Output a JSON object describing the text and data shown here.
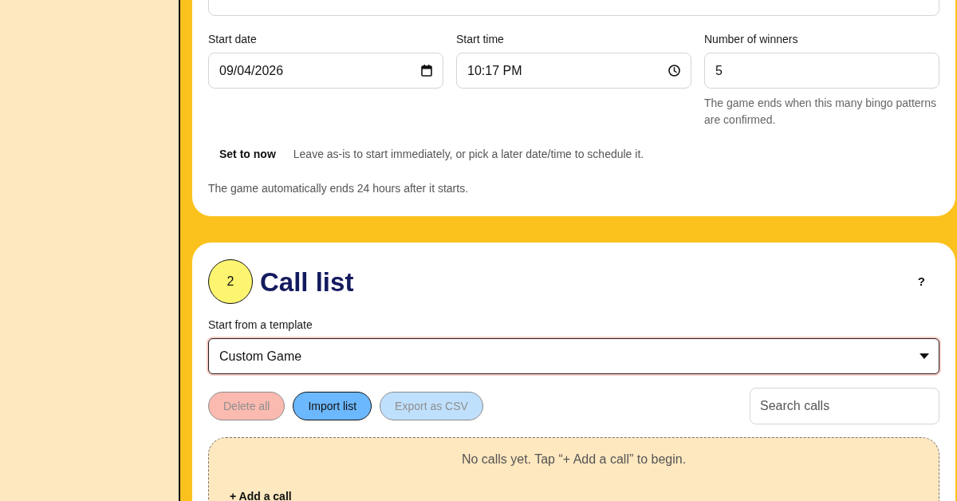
{
  "schedule": {
    "fields": [
      {
        "kind": "date",
        "label": "Start date",
        "value": "09/04/2026"
      },
      {
        "kind": "time",
        "label": "Start time",
        "value": "10:17 PM"
      },
      {
        "kind": "number",
        "label": "Number of winners",
        "value": "5",
        "help": "The game ends when this many bingo patterns are confirmed."
      }
    ],
    "set_now_button": "Set to now",
    "set_now_hint": "Leave as-is to start immediately, or pick a later date/time to schedule it.",
    "footnote": "The game automatically ends 24 hours after it starts."
  },
  "call_list": {
    "step": "2",
    "title": "Call list",
    "help_button": "?",
    "template_label": "Start from a template",
    "template": {
      "value": "Custom Game",
      "focused": true
    },
    "actions": [
      {
        "kind": "danger",
        "label": "Delete all",
        "disabled": true
      },
      {
        "kind": "normal",
        "label": "Import list",
        "disabled": false
      },
      {
        "kind": "normal",
        "label": "Export as CSV",
        "disabled": true
      }
    ],
    "search": {
      "placeholder": "Search calls"
    },
    "empty_message": "No calls yet. Tap “+ Add a call” to begin.",
    "add_button": "+ Add a call"
  }
}
